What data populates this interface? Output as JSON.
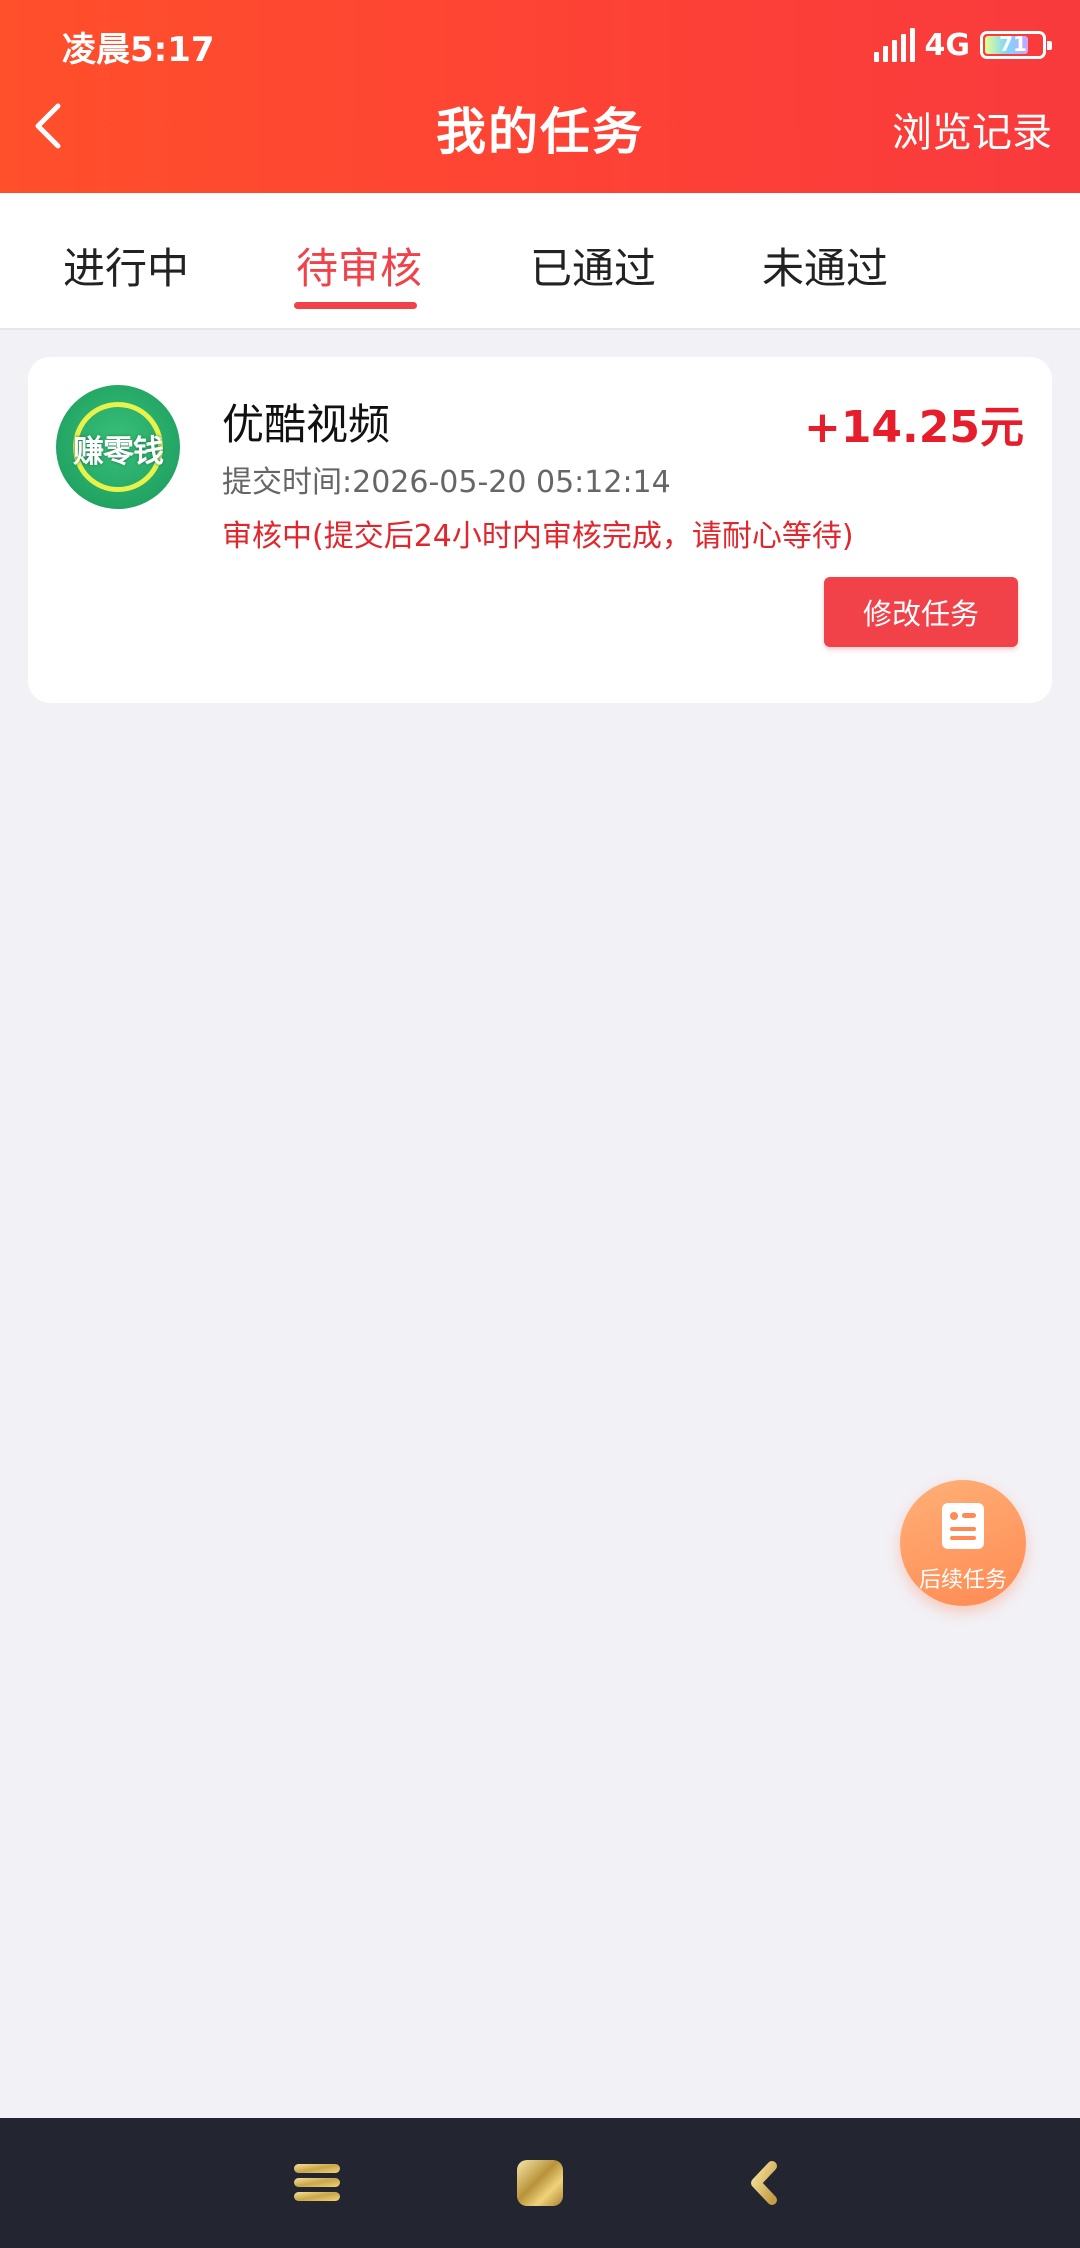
{
  "status_bar": {
    "time": "凌晨5:17",
    "network": "4G",
    "battery": "71",
    "battery_level": 0.71
  },
  "header": {
    "title": "我的任务",
    "right_link": "浏览记录",
    "back_icon": "chevron-left-icon"
  },
  "tabs": [
    {
      "label": "进行中"
    },
    {
      "label": "待审核"
    },
    {
      "label": "已通过"
    },
    {
      "label": "未通过"
    }
  ],
  "active_tab": "待审核",
  "task": {
    "logo_text": "赚零钱",
    "name": "优酷视频",
    "reward": "+14.25元",
    "submit_time": "提交时间:2026-05-20 05:12:14",
    "status": "审核中(提交后24小时内审核完成，请耐心等待)",
    "action_label": "修改任务"
  },
  "fab": {
    "label": "后续任务",
    "icon": "document-list-icon"
  },
  "navbar": {
    "menu_icon": "menu-icon",
    "home_icon": "home-icon",
    "back_icon": "back-icon"
  },
  "colors": {
    "accent": "#f1424a",
    "reward": "#e61e2b",
    "header_start": "#ff4f2b",
    "header_end": "#f93a3d"
  }
}
